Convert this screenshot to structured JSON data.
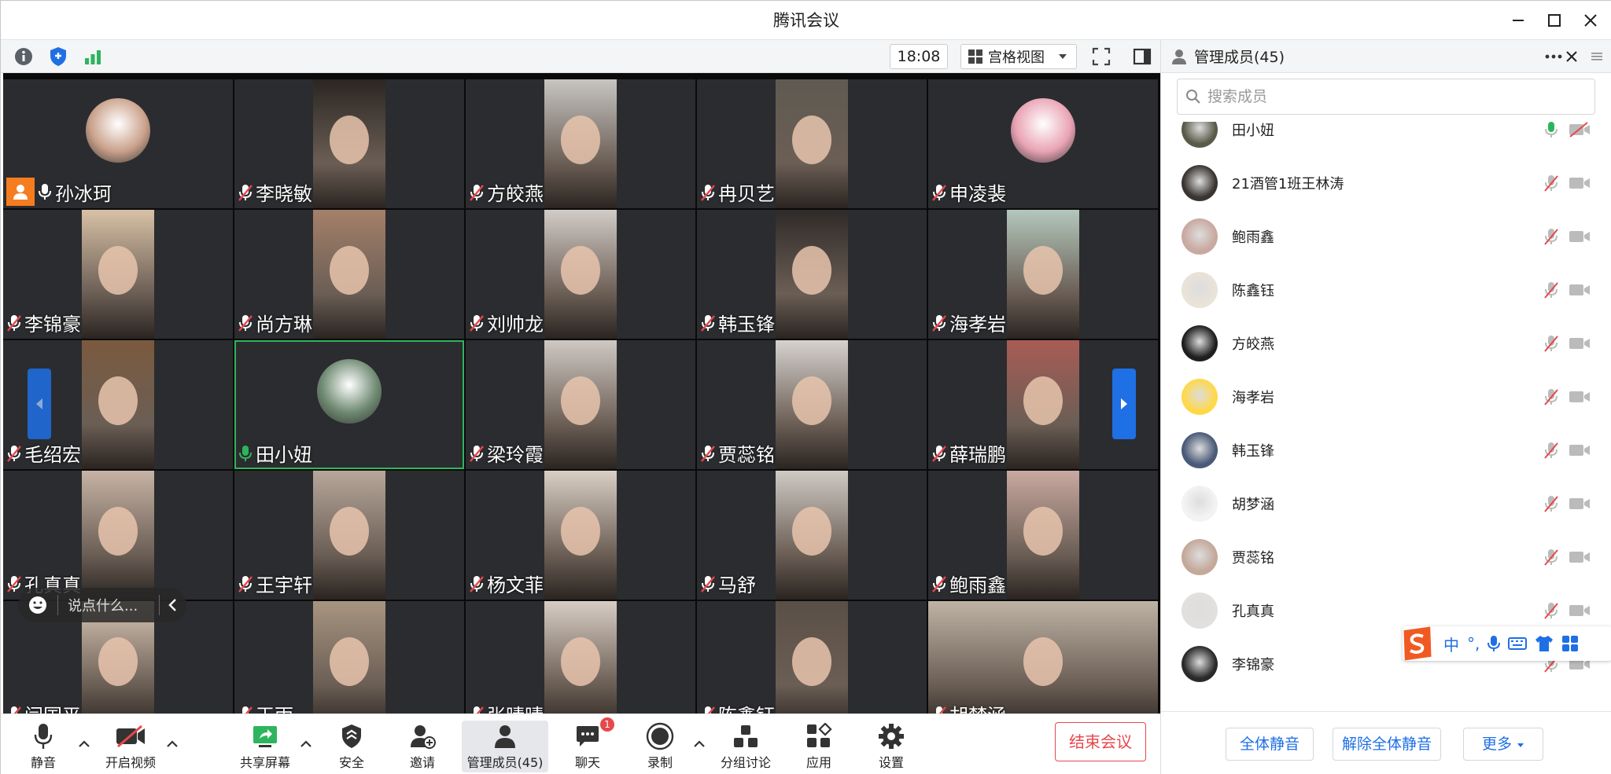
{
  "window": {
    "title": "腾讯会议"
  },
  "topbar": {
    "time": "18:08",
    "view_label": "宫格视图"
  },
  "colors": {
    "accent": "#1f6fe5",
    "danger": "#e8474b",
    "speaking": "#2db55d",
    "host": "#f57c1f"
  },
  "tiles": [
    {
      "name": "孙冰珂",
      "mic": "on",
      "host": true,
      "kind": "avatar",
      "bg": "#caa18b"
    },
    {
      "name": "李晓敏",
      "mic": "muted",
      "kind": "video",
      "bg": "#2b2622"
    },
    {
      "name": "方皎燕",
      "mic": "muted",
      "kind": "video",
      "bg": "#c7c5c2"
    },
    {
      "name": "冉贝艺",
      "mic": "muted",
      "kind": "video",
      "bg": "#5f5a51"
    },
    {
      "name": "申凌裴",
      "mic": "muted",
      "kind": "avatar",
      "bg": "#e9a3b4"
    },
    {
      "name": "李锦豪",
      "mic": "muted",
      "kind": "video",
      "bg": "#d8c1a6"
    },
    {
      "name": "尚方琳",
      "mic": "muted",
      "kind": "video",
      "bg": "#a48069"
    },
    {
      "name": "刘帅龙",
      "mic": "muted",
      "kind": "video",
      "bg": "#d2cbc6"
    },
    {
      "name": "韩玉锋",
      "mic": "muted",
      "kind": "video",
      "bg": "#2f2a28"
    },
    {
      "name": "海孝岩",
      "mic": "muted",
      "kind": "video",
      "bg": "#b3c8bd"
    },
    {
      "name": "毛绍宏",
      "mic": "muted",
      "kind": "video",
      "bg": "#7a5a3e"
    },
    {
      "name": "田小妞",
      "mic": "speaking",
      "kind": "avatar",
      "bg": "#6f8a72",
      "active": true
    },
    {
      "name": "梁玲霞",
      "mic": "muted",
      "kind": "video",
      "bg": "#cfc9c3"
    },
    {
      "name": "贾蕊铭",
      "mic": "muted",
      "kind": "video",
      "bg": "#d6d2ce"
    },
    {
      "name": "薛瑞鹏",
      "mic": "muted",
      "kind": "video",
      "bg": "#a85c55"
    },
    {
      "name": "孔真真",
      "mic": "muted",
      "kind": "video",
      "bg": "#c7b3a5"
    },
    {
      "name": "王宇轩",
      "mic": "muted",
      "kind": "video",
      "bg": "#b7a79a"
    },
    {
      "name": "杨文菲",
      "mic": "muted",
      "kind": "video",
      "bg": "#d9cfc5"
    },
    {
      "name": "马舒",
      "mic": "muted",
      "kind": "video",
      "bg": "#cfcac5"
    },
    {
      "name": "鲍雨鑫",
      "mic": "muted",
      "kind": "video",
      "bg": "#c9a9a0"
    },
    {
      "name": "闫国平",
      "mic": "muted",
      "kind": "video",
      "bg": "#d9c7b6"
    },
    {
      "name": "王雨",
      "mic": "muted",
      "kind": "video",
      "bg": "#a89580"
    },
    {
      "name": "张晴晴",
      "mic": "muted",
      "kind": "video",
      "bg": "#d8cdc4"
    },
    {
      "name": "陈鑫钰",
      "mic": "muted",
      "kind": "video",
      "bg": "#5a4f46"
    },
    {
      "name": "胡梦涵",
      "mic": "muted",
      "kind": "wide",
      "bg": "#bfb3a5"
    }
  ],
  "chat_input": {
    "placeholder": "说点什么..."
  },
  "toolbar": {
    "mute": "静音",
    "video": "开启视频",
    "share": "共享屏幕",
    "security": "安全",
    "invite": "邀请",
    "members": "管理成员(45)",
    "chat": "聊天",
    "chat_badge": "1",
    "record": "录制",
    "breakout": "分组讨论",
    "apps": "应用",
    "settings": "设置",
    "end": "结束会议"
  },
  "panel": {
    "title": "管理成员(45)",
    "search_placeholder": "搜索成员",
    "members": [
      {
        "name": "田小妞",
        "mic": "on",
        "cam": "off",
        "avatar": "#5a5a4a"
      },
      {
        "name": "21酒管1班王林涛",
        "mic": "off",
        "cam": "on",
        "avatar": "#3a3532"
      },
      {
        "name": "鲍雨鑫",
        "mic": "off",
        "cam": "on",
        "avatar": "#c9a9a0"
      },
      {
        "name": "陈鑫钰",
        "mic": "off",
        "cam": "on",
        "avatar": "#e9e3d8"
      },
      {
        "name": "方皎燕",
        "mic": "off",
        "cam": "on",
        "avatar": "#1f1f1f"
      },
      {
        "name": "海孝岩",
        "mic": "off",
        "cam": "on",
        "avatar": "#ffd84a"
      },
      {
        "name": "韩玉锋",
        "mic": "off",
        "cam": "on",
        "avatar": "#4a5a78"
      },
      {
        "name": "胡梦涵",
        "mic": "off",
        "cam": "on",
        "avatar": "#f3f3f3"
      },
      {
        "name": "贾蕊铭",
        "mic": "off",
        "cam": "on",
        "avatar": "#c4a89a"
      },
      {
        "name": "孔真真",
        "mic": "off",
        "cam": "on",
        "avatar": "#e2e0de"
      },
      {
        "name": "李锦豪",
        "mic": "off",
        "cam": "on",
        "avatar": "#2a2a2a"
      }
    ],
    "mute_all": "全体静音",
    "unmute_all": "解除全体静音",
    "more": "更多"
  },
  "ime": {
    "mode": "中",
    "punct": "°,"
  }
}
